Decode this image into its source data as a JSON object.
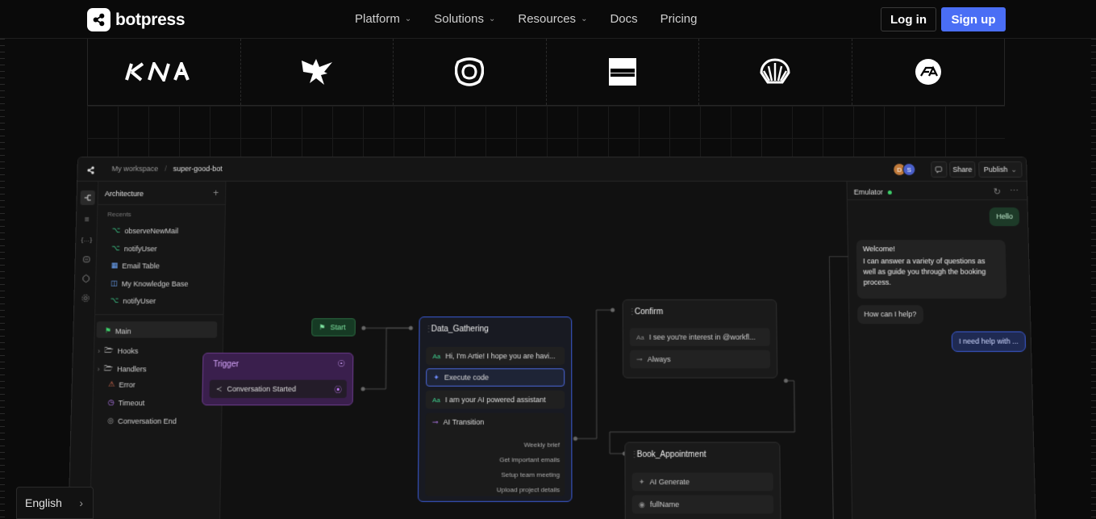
{
  "brand": {
    "name": "botpress"
  },
  "nav": {
    "links": [
      {
        "label": "Platform",
        "dropdown": true
      },
      {
        "label": "Solutions",
        "dropdown": true
      },
      {
        "label": "Resources",
        "dropdown": true
      },
      {
        "label": "Docs",
        "dropdown": false
      },
      {
        "label": "Pricing",
        "dropdown": false
      }
    ],
    "login_label": "Log in",
    "signup_label": "Sign up"
  },
  "customer_logos": [
    "kia-logo",
    "eagle-logo",
    "swirl-logo",
    "american-express-logo",
    "shell-logo",
    "ea-logo"
  ],
  "app": {
    "breadcrumb": {
      "workspace": "My workspace",
      "bot": "super-good-bot"
    },
    "avatars": [
      "D",
      "S"
    ],
    "share_label": "Share",
    "publish_label": "Publish",
    "sidebar": {
      "title": "Architecture",
      "recents_label": "Recents",
      "recents": [
        {
          "label": "observeNewMail",
          "icon": "workflow-icon"
        },
        {
          "label": "notifyUser",
          "icon": "workflow-icon"
        },
        {
          "label": "Email Table",
          "icon": "table-icon"
        },
        {
          "label": "My Knowledge Base",
          "icon": "book-icon"
        },
        {
          "label": "notifyUser",
          "icon": "workflow-icon"
        }
      ],
      "tree": [
        {
          "label": "Main",
          "icon": "flag-icon"
        },
        {
          "label": "Hooks",
          "icon": "folder-icon"
        },
        {
          "label": "Handlers",
          "icon": "folder-icon"
        },
        {
          "label": "Error",
          "icon": "warning-icon"
        },
        {
          "label": "Timeout",
          "icon": "clock-icon"
        },
        {
          "label": "Conversation End",
          "icon": "end-icon"
        }
      ]
    },
    "canvas": {
      "start_label": "Start",
      "trigger": {
        "title": "Trigger",
        "item": "Conversation Started"
      },
      "data_gathering": {
        "title": "Data_Gathering",
        "items": [
          "Hi, I'm Artie! I hope you are havi...",
          "Execute code",
          "I am your AI powered assistant",
          "AI Transition"
        ],
        "transitions": [
          "Weekly brief",
          "Get important emails",
          "Setup team meeting",
          "Upload project details"
        ]
      },
      "confirm": {
        "title": "Confirm",
        "items": [
          "I see you're interest in @workfl...",
          "Always"
        ]
      },
      "book_appointment": {
        "title": "Book_Appointment",
        "items": [
          "AI Generate",
          "fullName"
        ]
      }
    },
    "emulator": {
      "title": "Emulator",
      "messages": [
        {
          "from": "user",
          "text": "Hello"
        },
        {
          "from": "bot",
          "text": "Welcome!"
        },
        {
          "from": "bot",
          "text": "I can answer a variety of questions as well as guide you through the booking process."
        },
        {
          "from": "bot",
          "text": "How can I help?"
        },
        {
          "from": "user",
          "text": "I need help with ..."
        }
      ]
    }
  },
  "language": {
    "label": "English"
  },
  "colors": {
    "accent": "#4a6ef5",
    "start_green": "#3ecf6a",
    "trigger_purple": "#a855f7",
    "node_blue": "#3b5bd6"
  }
}
